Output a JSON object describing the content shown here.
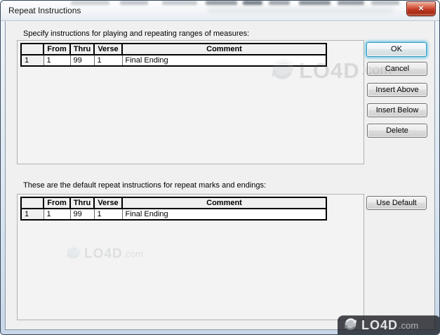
{
  "window": {
    "title": "Repeat Instructions"
  },
  "icons": {
    "close": "×"
  },
  "sections": {
    "playing": {
      "label": "Specify instructions for playing and repeating ranges of measures:",
      "table": {
        "headers": [
          "",
          "From",
          "Thru",
          "Verse",
          "Comment"
        ],
        "rows": [
          [
            "1",
            "1",
            "99",
            "1",
            "Final Ending"
          ]
        ]
      }
    },
    "defaults": {
      "label": "These are the default repeat instructions for repeat marks and endings:",
      "table": {
        "headers": [
          "",
          "From",
          "Thru",
          "Verse",
          "Comment"
        ],
        "rows": [
          [
            "1",
            "1",
            "99",
            "1",
            "Final Ending"
          ]
        ]
      }
    }
  },
  "buttons": {
    "ok": "OK",
    "cancel": "Cancel",
    "insert_above": "Insert Above",
    "insert_below": "Insert Below",
    "delete": "Delete",
    "use_default": "Use Default"
  },
  "watermark": {
    "brand": "LO4D",
    "suffix": ".com"
  },
  "colors": {
    "dialog_bg": "#f0f0f0",
    "close_button_red": "#c43a24",
    "default_button_glow": "#56c2e4",
    "grid_border": "#000000"
  }
}
